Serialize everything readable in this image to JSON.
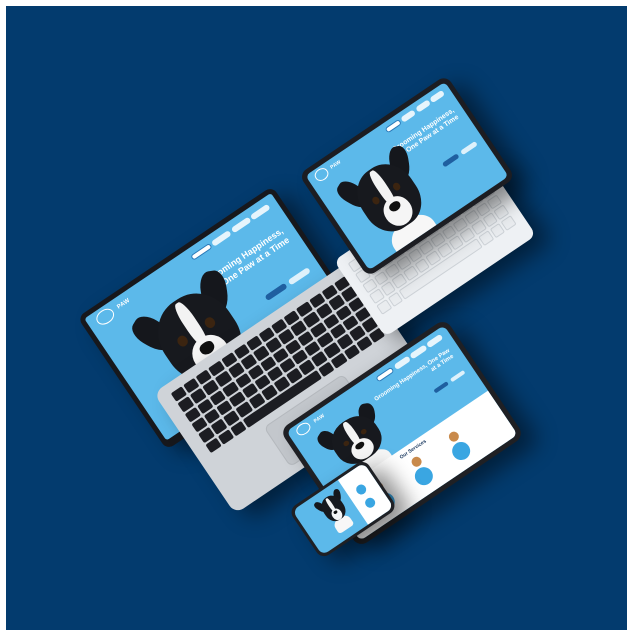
{
  "scene": {
    "background_color": "#033b6e",
    "devices": [
      "laptop",
      "tablet-with-keyboard",
      "tablet",
      "phone"
    ]
  },
  "website": {
    "brand": "PAW",
    "headline": "Grooming Happiness, One Paw at a Time",
    "services_title": "Our Services",
    "accent_color": "#5cb9ea",
    "button_color": "#1f5fa0"
  }
}
